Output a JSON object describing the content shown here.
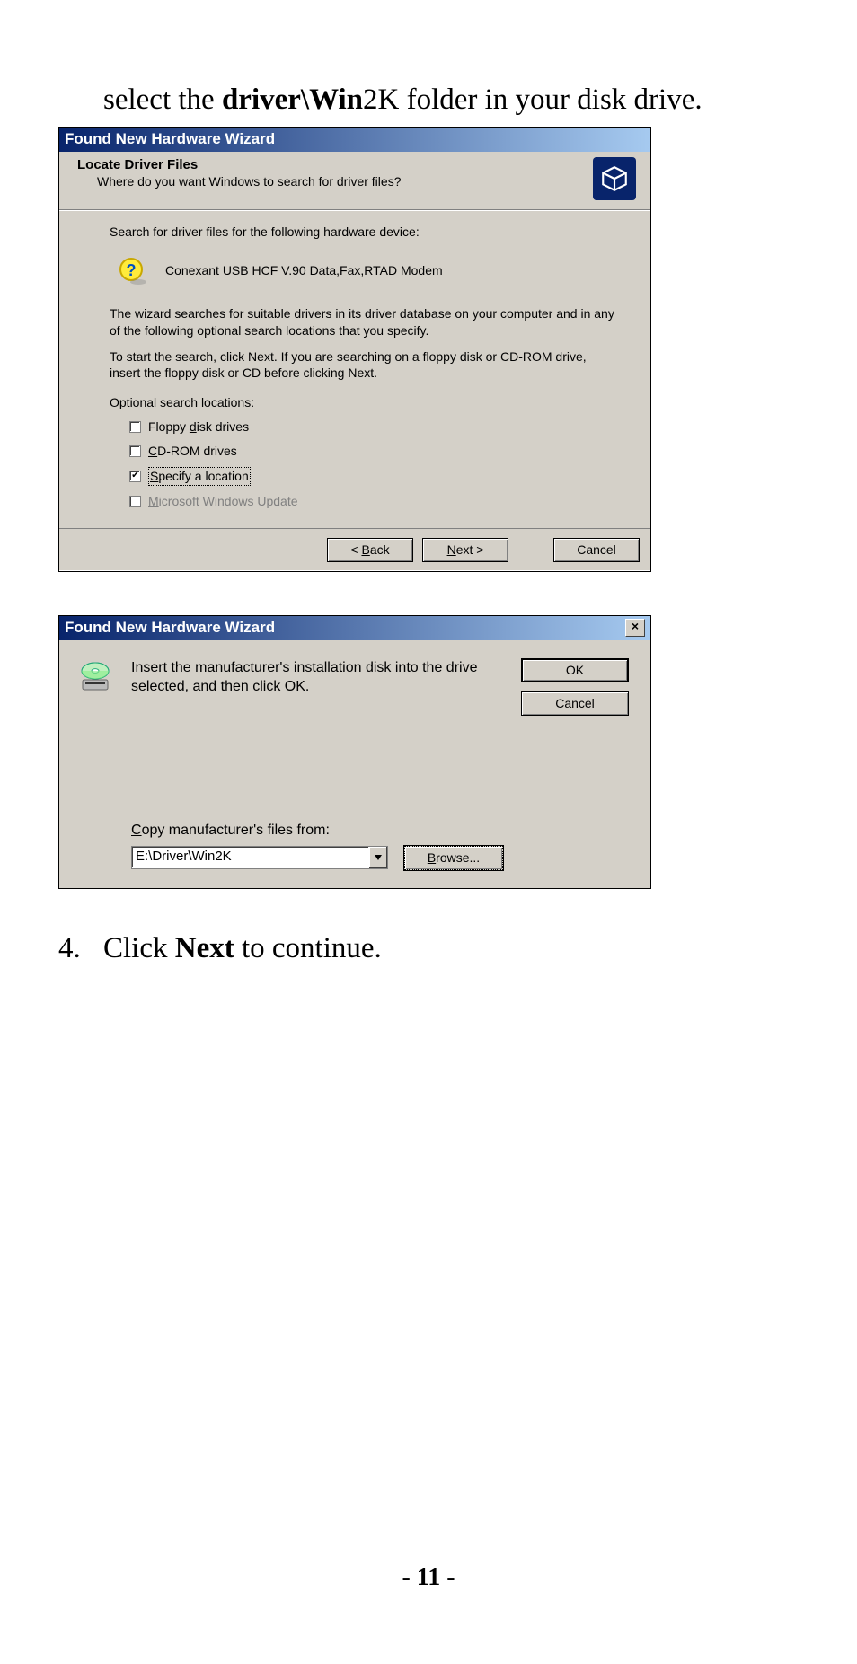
{
  "instruction": {
    "prefix": "select the ",
    "bold1": "driver\\Win",
    "mid": "2K folder in your disk drive."
  },
  "dialog1": {
    "title": "Found New Hardware Wizard",
    "header_title": "Locate Driver Files",
    "header_sub": "Where do you want Windows to search for driver files?",
    "line1": "Search for driver files for the following hardware device:",
    "device": "Conexant USB HCF V.90 Data,Fax,RTAD Modem",
    "para1": "The wizard searches for suitable drivers in its driver database on your computer and in any of the following optional search locations that you specify.",
    "para2": "To start the search, click Next. If you are searching on a floppy disk or CD-ROM drive, insert the floppy disk or CD before clicking Next.",
    "opt_label": "Optional search locations:",
    "checks": [
      {
        "checked": false,
        "u": "d",
        "rest": "isk drives",
        "pre": "Floppy ",
        "disabled": false
      },
      {
        "checked": false,
        "u": "C",
        "rest": "D-ROM drives",
        "pre": "",
        "disabled": false
      },
      {
        "checked": true,
        "u": "S",
        "rest": "pecify a location",
        "pre": "",
        "focus": true,
        "disabled": false
      },
      {
        "checked": false,
        "u": "M",
        "rest": "icrosoft Windows Update",
        "pre": "",
        "disabled": true
      }
    ],
    "buttons": {
      "back_lt": "< ",
      "back_u": "B",
      "back_rest": "ack",
      "next_u": "N",
      "next_rest": "ext >",
      "cancel": "Cancel"
    }
  },
  "dialog2": {
    "title": "Found New Hardware Wizard",
    "text": "Insert the manufacturer's installation disk into the drive selected, and then click OK.",
    "ok": "OK",
    "cancel": "Cancel",
    "copy_pre": "",
    "copy_u": "C",
    "copy_rest": "opy manufacturer's files from:",
    "path": "E:\\Driver\\Win2K",
    "browse_u": "B",
    "browse_rest": "rowse..."
  },
  "step": {
    "num": "4.",
    "pre": "Click ",
    "bold": "Next",
    "rest": " to continue."
  },
  "page_number": "- 11 -"
}
